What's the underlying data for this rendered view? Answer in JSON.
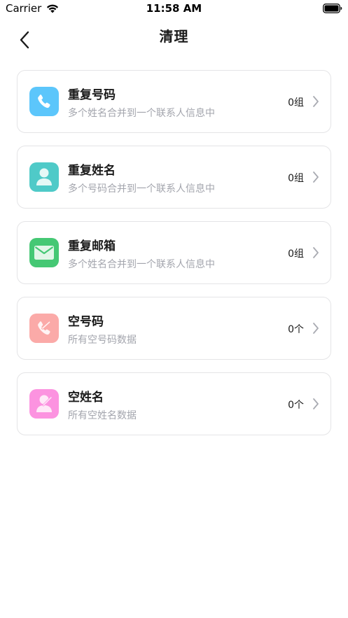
{
  "status_bar": {
    "carrier": "Carrier",
    "time": "11:58 AM"
  },
  "nav": {
    "title": "清理"
  },
  "items": [
    {
      "title": "重复号码",
      "subtitle": "多个姓名合并到一个联系人信息中",
      "count": "0组",
      "icon": "phone-icon",
      "color": "#5cc6fb"
    },
    {
      "title": "重复姓名",
      "subtitle": "多个号码合并到一个联系人信息中",
      "count": "0组",
      "icon": "person-icon",
      "color": "#4fcac8"
    },
    {
      "title": "重复邮箱",
      "subtitle": "多个姓名合并到一个联系人信息中",
      "count": "0组",
      "icon": "mail-icon",
      "color": "#45c874"
    },
    {
      "title": "空号码",
      "subtitle": "所有空号码数据",
      "count": "0个",
      "icon": "phone-off-icon",
      "color": "#fbaaa8"
    },
    {
      "title": "空姓名",
      "subtitle": "所有空姓名数据",
      "count": "0个",
      "icon": "person-off-icon",
      "color": "#fc93e0"
    }
  ]
}
